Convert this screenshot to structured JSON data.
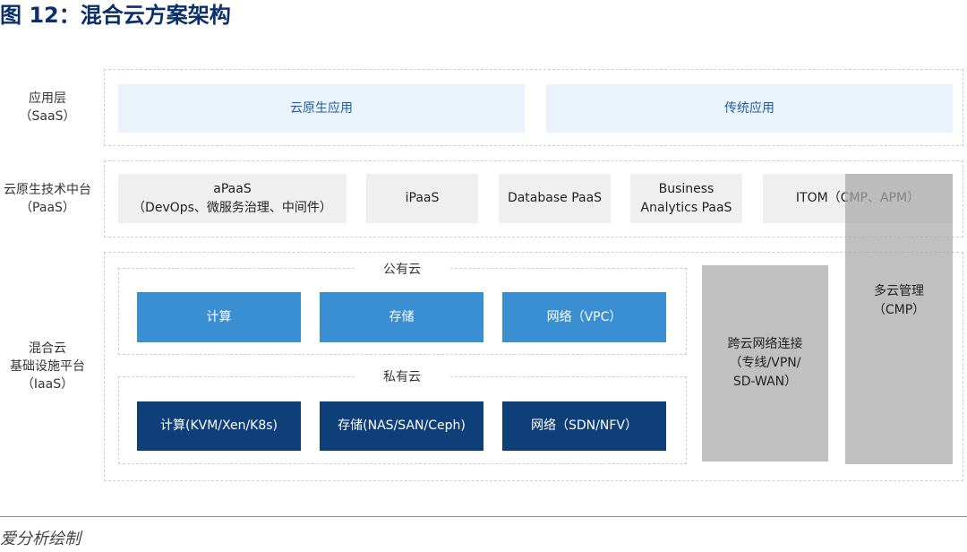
{
  "title": "图 12：混合云方案架构",
  "layers": {
    "saas": {
      "label": "应用层\n（SaaS）",
      "items": [
        "云原生应用",
        "传统应用"
      ]
    },
    "paas": {
      "label": "云原生技术中台\n（PaaS）",
      "items": [
        "aPaaS\n（DevOps、微服务治理、中间件）",
        "iPaaS",
        "Database PaaS",
        "Business\nAnalytics PaaS",
        "ITOM（CMP、APM）"
      ]
    },
    "iaas": {
      "label": "混合云\n基础设施平台\n（IaaS）",
      "public_cloud": {
        "title": "公有云",
        "items": [
          "计算",
          "存储",
          "网络（VPC）"
        ]
      },
      "private_cloud": {
        "title": "私有云",
        "items": [
          "计算(KVM/Xen/K8s)",
          "存储(NAS/SAN/Ceph)",
          "网络（SDN/NFV）"
        ]
      },
      "cross_cloud": "跨云网络连接\n（专线/VPN/\nSD-WAN）"
    }
  },
  "cmp": "多云管理\n（CMP）",
  "source": "爱分析绘制",
  "colors": {
    "title": "#0b2f6b",
    "saas_fill": "#eaf3fb",
    "public_cloud": "#3a8fd3",
    "private_cloud": "#0f3f78",
    "paas_fill": "#efefef",
    "gray": "#c0c0c0"
  }
}
